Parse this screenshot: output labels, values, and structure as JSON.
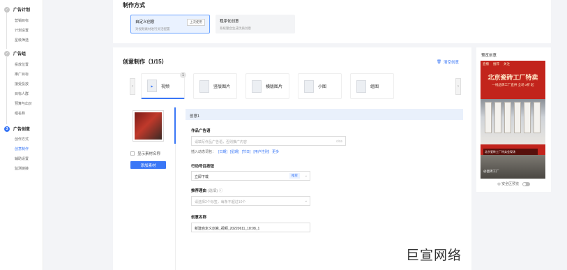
{
  "sidebar": {
    "groups": [
      {
        "title": "广告计划",
        "marker": "✓",
        "items": [
          "营销目标",
          "计划设置",
          "星级筛选"
        ]
      },
      {
        "title": "广告组",
        "marker": "✓",
        "items": [
          "投放位置",
          "推广目标",
          "接受投放",
          "目标人群",
          "预算与出价",
          "组名称"
        ]
      },
      {
        "title": "广告创意",
        "marker": "3",
        "items": [
          "创作方式",
          "创意制作",
          "辅助设置",
          "监测链接"
        ]
      }
    ]
  },
  "method_section": {
    "title": "制作方式",
    "custom": {
      "title": "自定义创意",
      "desc": "对视频素材进行灵活配置",
      "tag": "上次使用"
    },
    "programmatic": {
      "title": "程序化创意",
      "desc": "系统整合生成优质创意"
    }
  },
  "creative": {
    "title": "创意制作（1/15）",
    "clear_label": "清空创意",
    "tabs": [
      {
        "label": "视频",
        "badge": "1"
      },
      {
        "label": "竖版图片"
      },
      {
        "label": "横版图片"
      },
      {
        "label": "小图"
      },
      {
        "label": "组图"
      }
    ],
    "show_material_name": "显示素材名称",
    "add_material": "添加素材",
    "item_title": "创意1",
    "ad_copy_label": "作品广告语",
    "ad_copy_placeholder": "请填写作品广告语，否则推广内容",
    "ad_copy_count": "0/55",
    "insert_label": "插入动态词包：",
    "insert_links": [
      "[日期]",
      "[星期]",
      "[节日]",
      "[用户性别]",
      "更多"
    ],
    "cta_label": "行动号召按钮",
    "cta_value": "立即下载",
    "cta_tag": "推荐",
    "reason_label": "推荐理由",
    "reason_hint": "(选填)",
    "reason_placeholder": "请选择2个标签，每条不超过10个",
    "name_label": "创意名称",
    "name_value": "新建自定义创意_视频_20220611_18:08_1"
  },
  "preview": {
    "title": "预览创意",
    "nav": [
      "直播",
      "推荐",
      "关注"
    ],
    "headline": "北京瓷砖工厂特卖",
    "subline": "一线品牌工厂直供 全场 3折 起",
    "caption": "北京瓷砖工厂特卖会现场",
    "footer": "@瓷砖工厂",
    "safe_preview": "安全区预览"
  },
  "watermark": "巨宣网络",
  "colors": {
    "accent": "#3a77f6",
    "preview_bg": "#c2241c"
  }
}
